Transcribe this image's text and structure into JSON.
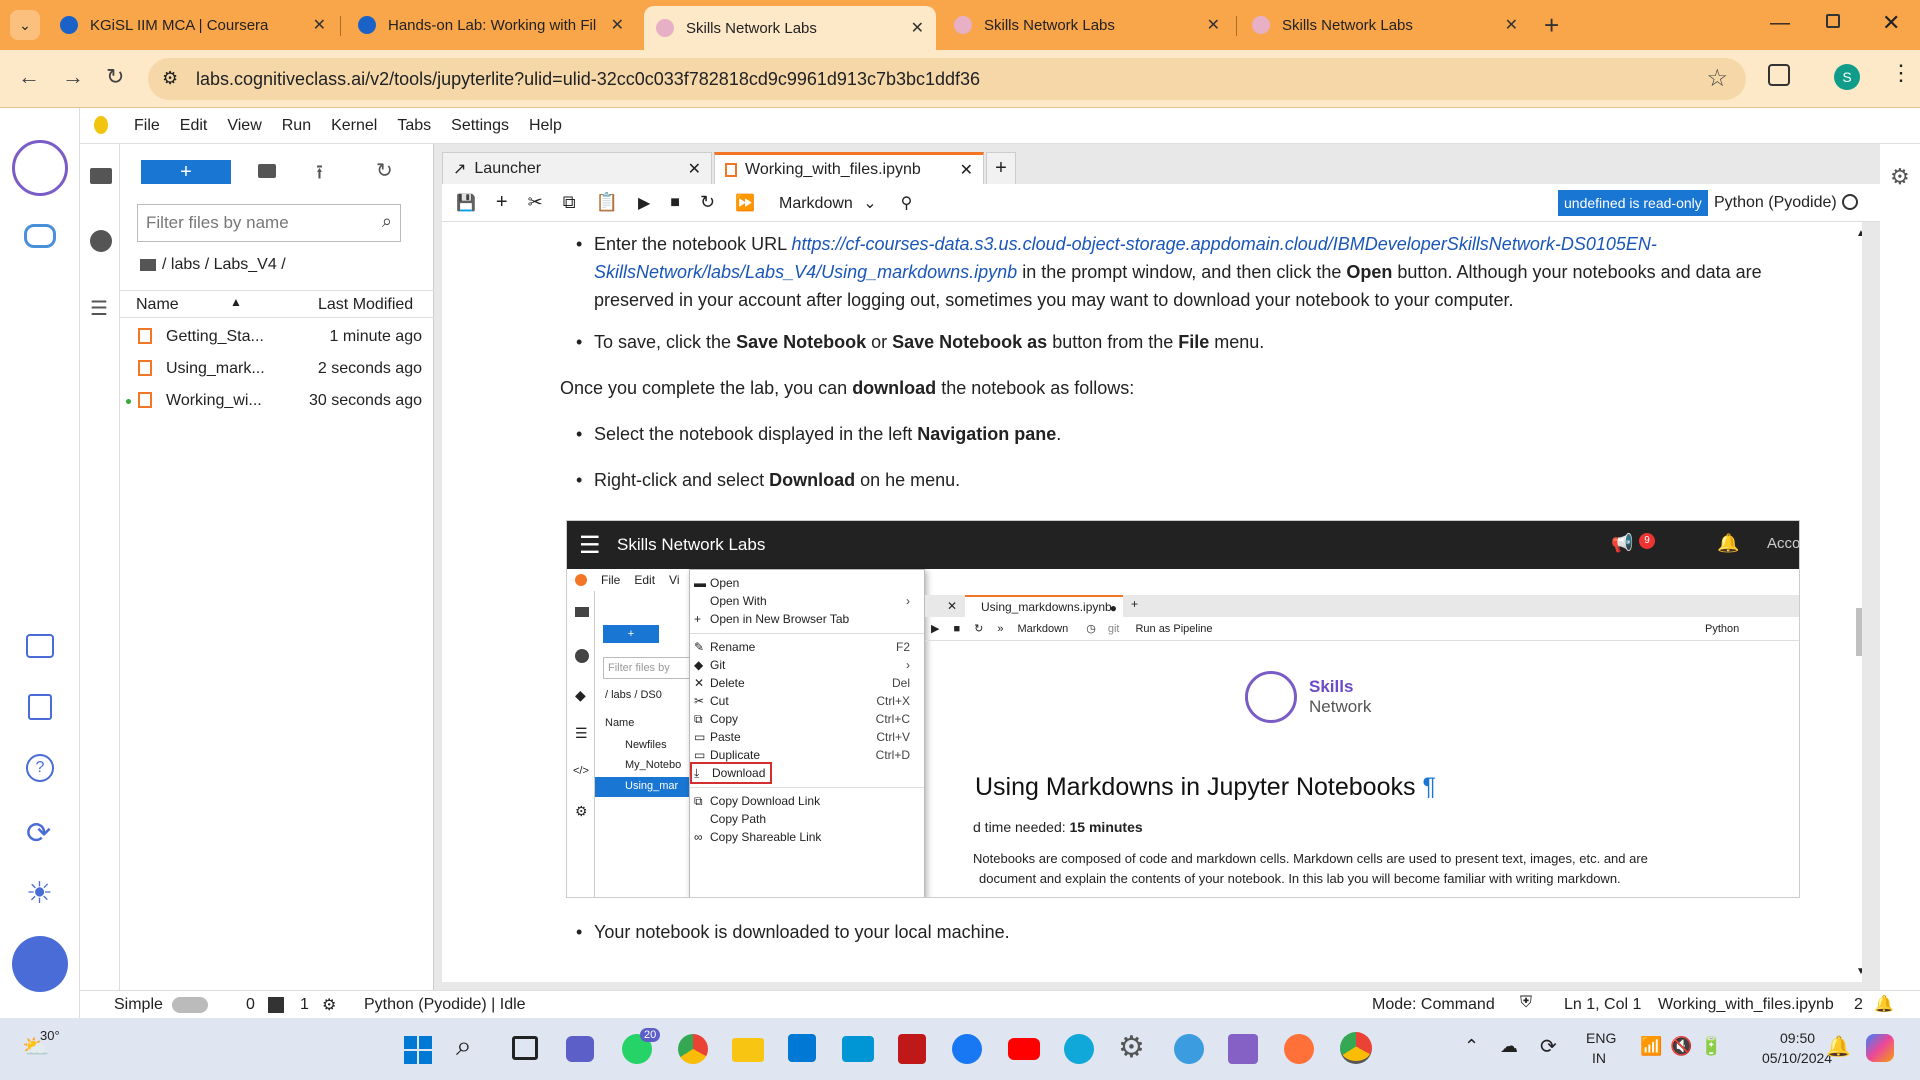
{
  "browser": {
    "tabs": [
      {
        "title": "KGiSL IIM MCA | Coursera",
        "close": "✕"
      },
      {
        "title": "Hands-on Lab: Working with Fil",
        "close": "✕"
      },
      {
        "title": "Skills Network Labs",
        "close": "✕"
      },
      {
        "title": "Skills Network Labs",
        "close": "✕"
      },
      {
        "title": "Skills Network Labs",
        "close": "✕"
      }
    ],
    "new_tab": "+",
    "url": "labs.cognitiveclass.ai/v2/tools/jupyterlite?ulid=ulid-32cc0c033f782818cd9c9961d913c7b3bc1ddf36",
    "profile_initial": "S"
  },
  "jupyter": {
    "menu": [
      "File",
      "Edit",
      "View",
      "Run",
      "Kernel",
      "Tabs",
      "Settings",
      "Help"
    ],
    "filebrowser": {
      "new_button": "+",
      "filter_placeholder": "Filter files by name",
      "breadcrumb": "/ labs / Labs_V4 /",
      "col_name": "Name",
      "col_modified": "Last Modified",
      "files": [
        {
          "name": "Getting_Sta...",
          "modified": "1 minute ago"
        },
        {
          "name": "Using_mark...",
          "modified": "2 seconds ago"
        },
        {
          "name": "Working_wi...",
          "modified": "30 seconds ago"
        }
      ]
    },
    "doc_tabs": [
      {
        "title": "Launcher",
        "close": "✕"
      },
      {
        "title": "Working_with_files.ipynb",
        "close": "✕"
      }
    ],
    "add_tab": "+",
    "toolbar": {
      "cell_type": "Markdown",
      "readonly_badge": "undefined is read-only",
      "kernel": "Python (Pyodide)"
    },
    "notebook": {
      "bullet1_pre": "Enter the notebook URL ",
      "bullet1_link": "https://cf-courses-data.s3.us.cloud-object-storage.appdomain.cloud/IBMDeveloperSkillsNetwork-DS0105EN-SkillsNetwork/labs/Labs_V4/Using_markdowns.ipynb",
      "bullet1_mid": " in the prompt window, and then click the ",
      "bullet1_open": "Open",
      "bullet1_post": " button. Although your notebooks and data are preserved in your account after logging out, sometimes you may want to download your notebook to your computer.",
      "bullet2_pre": "To save, click the ",
      "bullet2_save": "Save Notebook",
      "bullet2_or": " or ",
      "bullet2_saveas": "Save Notebook as",
      "bullet2_mid": " button from the ",
      "bullet2_file": "File",
      "bullet2_post": " menu.",
      "para_pre": "Once you complete the lab, you can ",
      "para_download": "download",
      "para_post": " the notebook as follows:",
      "bullet3_pre": "Select the notebook displayed in the left ",
      "bullet3_nav": "Navigation pane",
      "bullet3_post": ".",
      "bullet4_pre": "Right-click and select ",
      "bullet4_dl": "Download",
      "bullet4_post": " on he menu.",
      "bullet5": "Your notebook is downloaded to your local machine."
    },
    "embedded": {
      "header_title": "Skills Network Labs",
      "header_badge": "9",
      "header_account": "Acco",
      "menu": [
        "File",
        "Edit",
        "Vi"
      ],
      "filter_placeholder": "Filter files by",
      "breadcrumb": "/ labs / DS0",
      "col_name": "Name",
      "files": [
        "Newfiles",
        "My_Notebo",
        "Using_mar"
      ],
      "context_menu": [
        {
          "label": "Open",
          "shortcut": ""
        },
        {
          "label": "Open With",
          "shortcut": "›"
        },
        {
          "label": "Open in New Browser Tab",
          "shortcut": ""
        },
        {
          "label": "Rename",
          "shortcut": "F2"
        },
        {
          "label": "Git",
          "shortcut": "›"
        },
        {
          "label": "Delete",
          "shortcut": "Del"
        },
        {
          "label": "Cut",
          "shortcut": "Ctrl+X"
        },
        {
          "label": "Copy",
          "shortcut": "Ctrl+C"
        },
        {
          "label": "Paste",
          "shortcut": "Ctrl+V"
        },
        {
          "label": "Duplicate",
          "shortcut": "Ctrl+D"
        },
        {
          "label": "Download",
          "shortcut": ""
        },
        {
          "label": "Copy Download Link",
          "shortcut": ""
        },
        {
          "label": "Copy Path",
          "shortcut": ""
        },
        {
          "label": "Copy Shareable Link",
          "shortcut": ""
        }
      ],
      "tab_title": "Using_markdowns.ipynb",
      "toolbar_celltype": "Markdown",
      "toolbar_git": "git",
      "toolbar_pipeline": "Run as Pipeline",
      "toolbar_kernel": "Python",
      "logo_line1": "Skills",
      "logo_line2": "Network",
      "heading": "Using Markdowns in Jupyter Notebooks",
      "heading_pilcrow": "¶",
      "time_pre": "d time needed: ",
      "time_val": "15 minutes",
      "desc1": "Notebooks are composed of code and markdown cells. Markdown cells are used to present text, images, etc. and are",
      "desc2": "document and explain the contents of your notebook. In this lab you will become familiar with writing markdown."
    },
    "status": {
      "mode_label": "Simple",
      "count0": "0",
      "count1": "1",
      "kernel_status": "Python (Pyodide) | Idle",
      "mode": "Mode: Command",
      "position": "Ln 1, Col 1",
      "filename": "Working_with_files.ipynb",
      "notifications": "2"
    }
  },
  "taskbar": {
    "weather": "30°",
    "whatsapp_badge": "20",
    "lang1": "ENG",
    "lang2": "IN",
    "time": "09:50",
    "date": "05/10/2024"
  },
  "colors": {
    "tabstrip": "#f9a64a",
    "jupyter_blue": "#1976d2",
    "jupyter_orange": "#f37626",
    "link": "#1a56b8"
  }
}
